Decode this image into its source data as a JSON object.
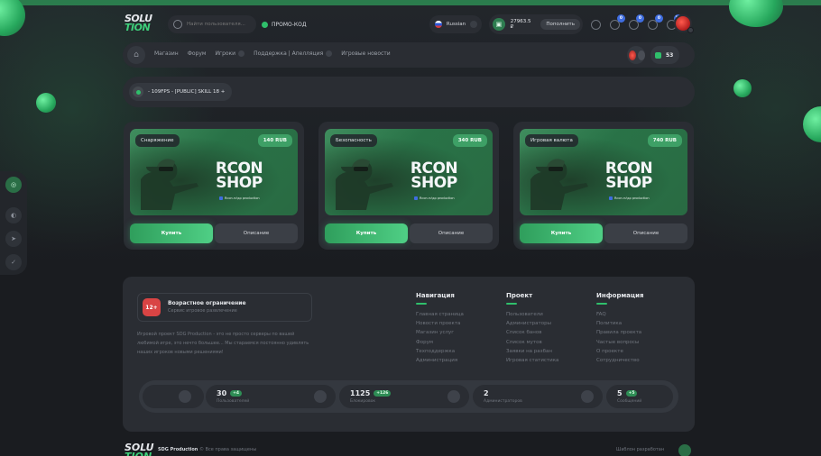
{
  "header": {
    "logo_top": "SOLU",
    "logo_bottom": "TION",
    "search_placeholder": "Найти пользователя...",
    "promo_label": "ПРОМО-КОД",
    "language": "Russian",
    "balance": "27963.5 ₽",
    "topup_label": "Пополнить",
    "notifications": [
      "0",
      "0",
      "0",
      "14"
    ]
  },
  "nav": {
    "items": [
      "Магазин",
      "Форум",
      "Игроки",
      "Поддержка | Апелляция",
      "Игровые новости"
    ],
    "online_count": "53"
  },
  "server": {
    "name": "- 109FPS - [PUBLIC] SKILL 18 +"
  },
  "cards": [
    {
      "category": "Снаряжение",
      "price": "140 RUB",
      "title_1": "RCON",
      "title_2": "SHOP",
      "made_by": "Rcon.ru\\sp production",
      "buy": "Купить",
      "desc": "Описание"
    },
    {
      "category": "Безопасность",
      "price": "340 RUB",
      "title_1": "RCON",
      "title_2": "SHOP",
      "made_by": "Rcon.ru\\sp production",
      "buy": "Купить",
      "desc": "Описание"
    },
    {
      "category": "Игровая валюта",
      "price": "740 RUB",
      "title_1": "RCON",
      "title_2": "SHOP",
      "made_by": "Rcon.ru\\sp production",
      "buy": "Купить",
      "desc": "Описание"
    }
  ],
  "footer": {
    "age_badge": "12+",
    "age_title": "Возрастное ограничение",
    "age_sub": "Сервис игровое развлечение",
    "about": "Игровой проект SDG Production - это не просто серверы по вашей любимой игре, это нечто большее... Мы стараемся постоянно удивлять наших игроков новыми решениями!",
    "columns": [
      {
        "title": "Навигация",
        "links": [
          "Главная страница",
          "Новости проекта",
          "Магазин услуг",
          "Форум",
          "Техподдержка",
          "Администрация"
        ]
      },
      {
        "title": "Проект",
        "links": [
          "Пользователи",
          "Администраторы",
          "Список банов",
          "Список мутов",
          "Заявки на разбан",
          "Игровая статистика"
        ]
      },
      {
        "title": "Информация",
        "links": [
          "FAQ",
          "Политика",
          "Правила проекта",
          "Частые вопросы",
          "О проекте",
          "Сотрудничество"
        ]
      }
    ],
    "stats": [
      {
        "value": "30",
        "plus": "+4",
        "label": "Пользователей"
      },
      {
        "value": "1125",
        "plus": "+126",
        "label": "Блокировок"
      },
      {
        "value": "2",
        "plus": "",
        "label": "Администраторов"
      },
      {
        "value": "5",
        "plus": "+5",
        "label": "Сообщений"
      }
    ],
    "copyright_brand": "SDG Production",
    "copyright_rest": " © Все права защищены",
    "template_by": "Шаблон разработан"
  },
  "colors": {
    "accent": "#2fbf6b",
    "panel": "#2a2d33",
    "bg": "#1b1d22"
  }
}
